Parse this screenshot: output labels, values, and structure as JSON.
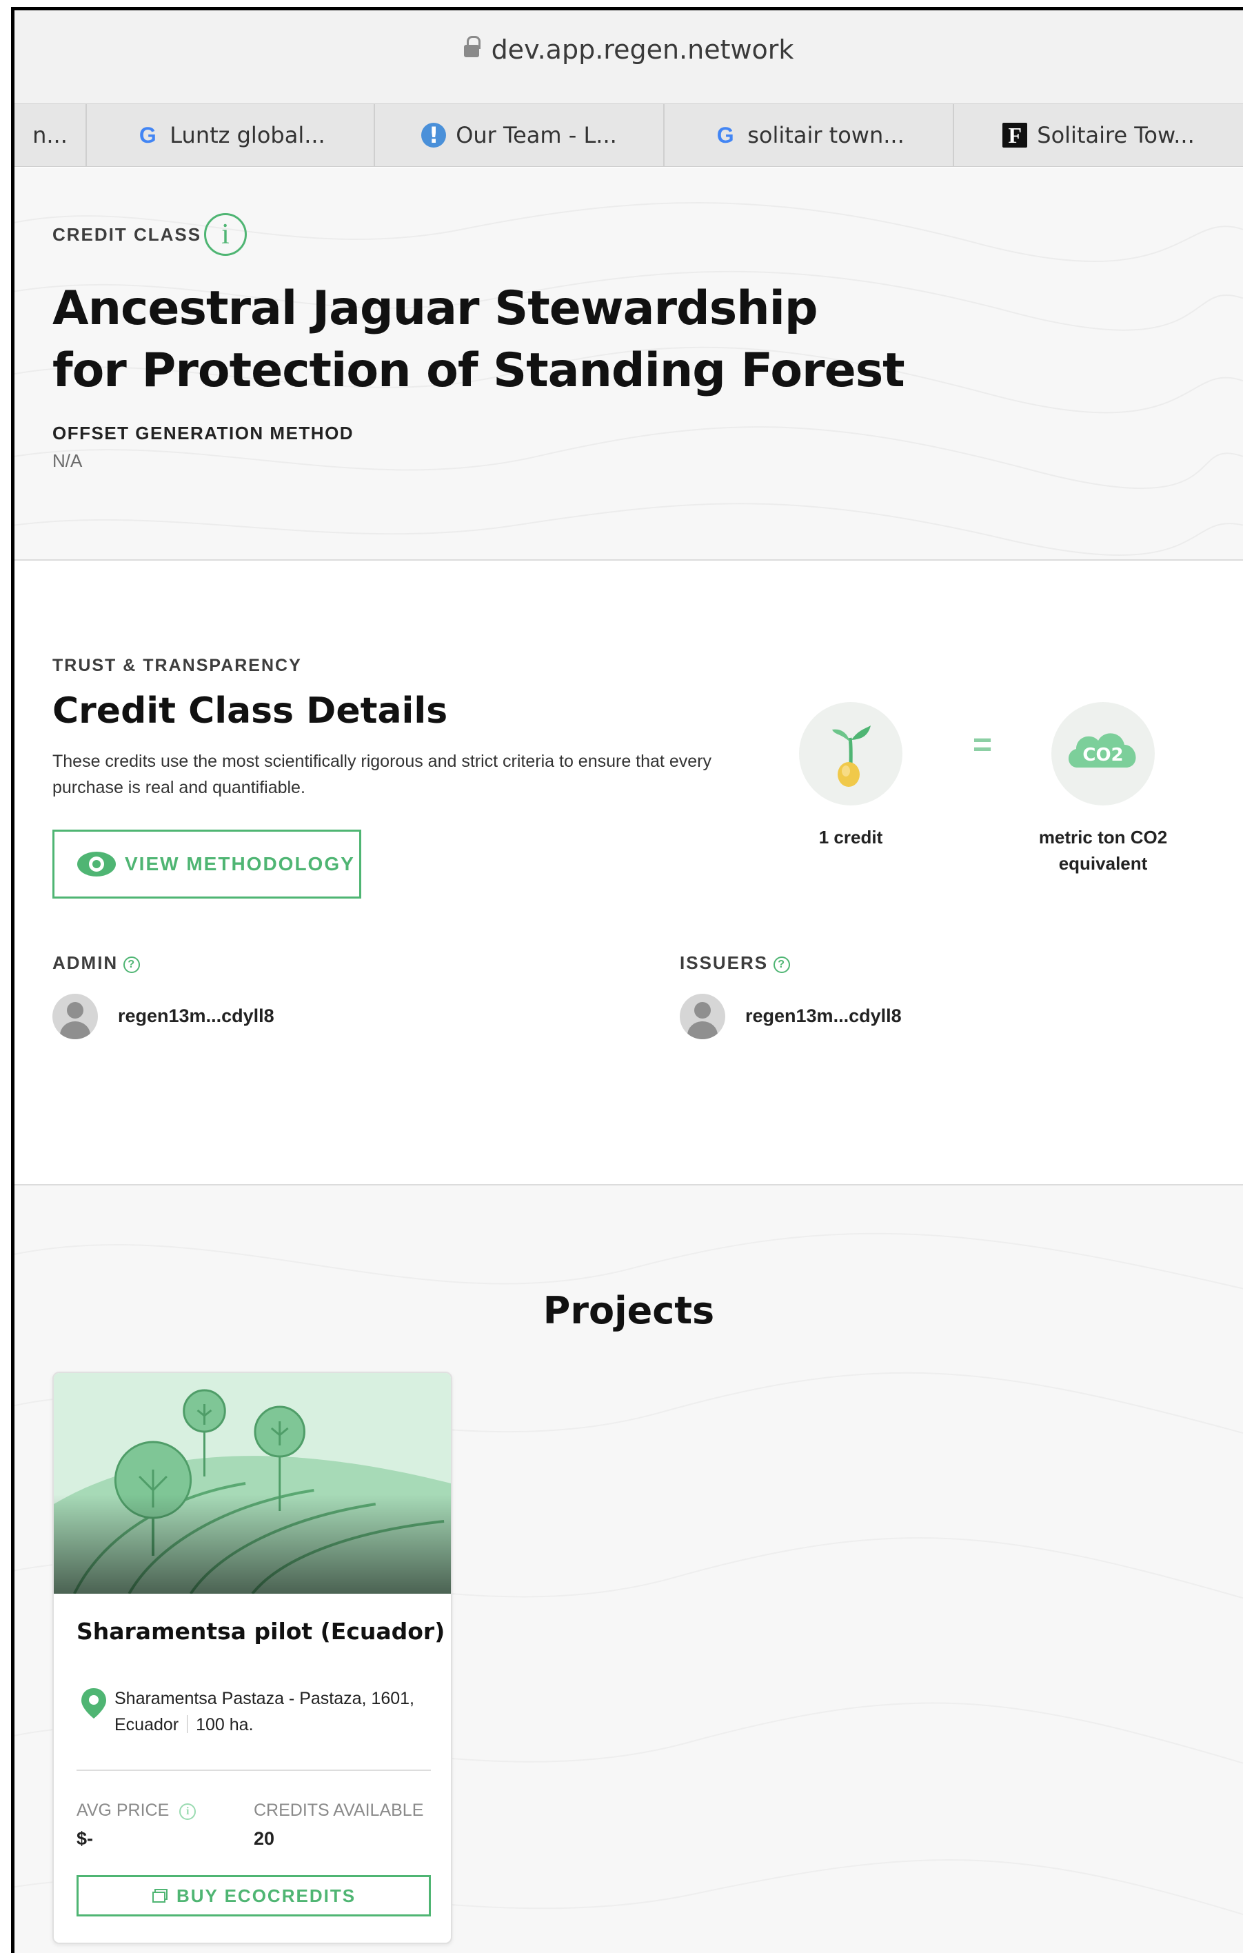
{
  "browser": {
    "url": "dev.app.regen.network",
    "tabs": [
      {
        "label": "n...",
        "icon": "none"
      },
      {
        "label": "Luntz global...",
        "icon": "google-icon"
      },
      {
        "label": "Our Team - L...",
        "icon": "chat-bubble-icon"
      },
      {
        "label": "solitair town...",
        "icon": "google-icon"
      },
      {
        "label": "Solitaire Tow...",
        "icon": "f-logo-icon"
      }
    ]
  },
  "header": {
    "eyebrow": "CREDIT CLASS",
    "title_line1": "Ancestral Jaguar Stewardship",
    "title_line2": "for Protection of Standing Forest",
    "method_label": "OFFSET GENERATION METHOD",
    "method_value": "N/A"
  },
  "details": {
    "eyebrow": "TRUST & TRANSPARENCY",
    "title": "Credit Class Details",
    "description": "These credits use the most scientifically rigorous and strict criteria to ensure that every purchase is real and quantifiable.",
    "methodology_button": "VIEW METHODOLOGY",
    "equation": {
      "left_caption": "1 credit",
      "equals": "=",
      "right_icon_text": "CO2",
      "right_caption_line1": "metric ton CO2",
      "right_caption_line2": "equivalent"
    },
    "admin": {
      "label": "ADMIN",
      "address": "regen13m...cdyll8"
    },
    "issuers": {
      "label": "ISSUERS",
      "address": "regen13m...cdyll8"
    }
  },
  "projects": {
    "title": "Projects",
    "cards": [
      {
        "name": "Sharamentsa pilot (Ecuador)",
        "location": "Sharamentsa Pastaza - Pastaza, 1601, Ecuador",
        "area": "100 ha.",
        "avg_price_label": "AVG PRICE",
        "avg_price": "$-",
        "credits_label": "CREDITS AVAILABLE",
        "credits": "20",
        "buy_button": "BUY ECOCREDITS"
      }
    ]
  },
  "colors": {
    "accent": "#4fb573",
    "section_bg": "#f7f7f7",
    "text": "#111111"
  }
}
